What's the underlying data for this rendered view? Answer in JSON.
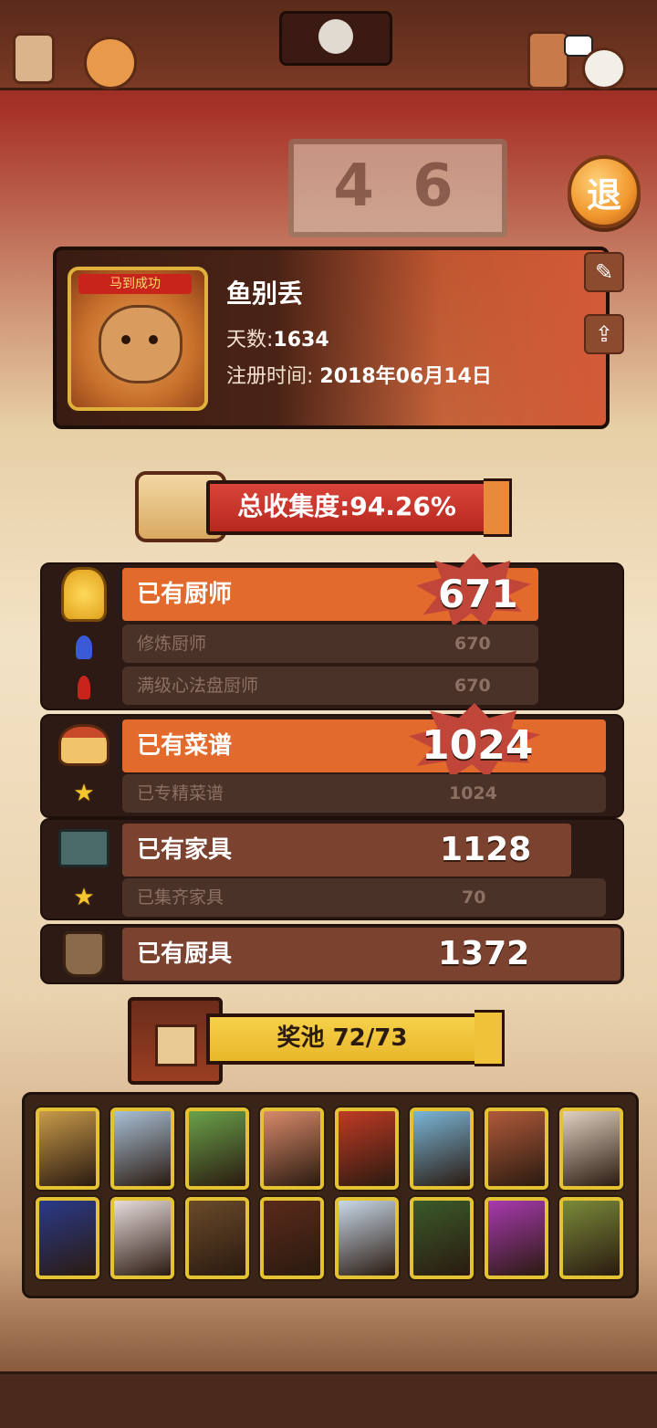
{
  "exit_button": "退",
  "background_sign": "4 6",
  "profile": {
    "name": "鱼别丢",
    "days_label": "天数:",
    "days_value": "1634",
    "reg_label": "注册时间: ",
    "reg_value": "2018年06月14日",
    "avatar_banner": "马到成功",
    "edit_icon": "edit-icon",
    "share_icon": "share-icon"
  },
  "collection_rate": "总收集度:94.26%",
  "stats": {
    "chefs": {
      "label": "已有厨师",
      "value": "671",
      "subs": [
        {
          "label": "修炼厨师",
          "value": "670"
        },
        {
          "label": "满级心法盘厨师",
          "value": "670"
        }
      ]
    },
    "recipes": {
      "label": "已有菜谱",
      "value": "1024",
      "subs": [
        {
          "label": "已专精菜谱",
          "value": "1024"
        }
      ]
    },
    "furniture": {
      "label": "已有家具",
      "value": "1128",
      "subs": [
        {
          "label": "已集齐家具",
          "value": "70"
        }
      ]
    },
    "tools": {
      "label": "已有厨具",
      "value": "1372"
    }
  },
  "prize_pool": {
    "label": "奖池  72/73",
    "collected": 72,
    "total": 73
  },
  "colors": {
    "orange_bar": "#e26a2c",
    "brown_bar": "#7b4230",
    "gold_frame": "#e5c232",
    "burst_red": "#c0463a"
  },
  "pool_cards": [
    {
      "color": "#c89a4a"
    },
    {
      "color": "#a9c0d6"
    },
    {
      "color": "#6aa24a"
    },
    {
      "color": "#d88a6a"
    },
    {
      "color": "#c03a24"
    },
    {
      "color": "#7ab6d8"
    },
    {
      "color": "#b05a3a"
    },
    {
      "color": "#e0d0c0"
    },
    {
      "color": "#2a3a8a"
    },
    {
      "color": "#e8dcdc"
    },
    {
      "color": "#6a4a2a"
    },
    {
      "color": "#5a2a1a"
    },
    {
      "color": "#c8d8e8"
    },
    {
      "color": "#3a5a2a"
    },
    {
      "color": "#a83ab0"
    },
    {
      "color": "#7a8a3a"
    }
  ]
}
